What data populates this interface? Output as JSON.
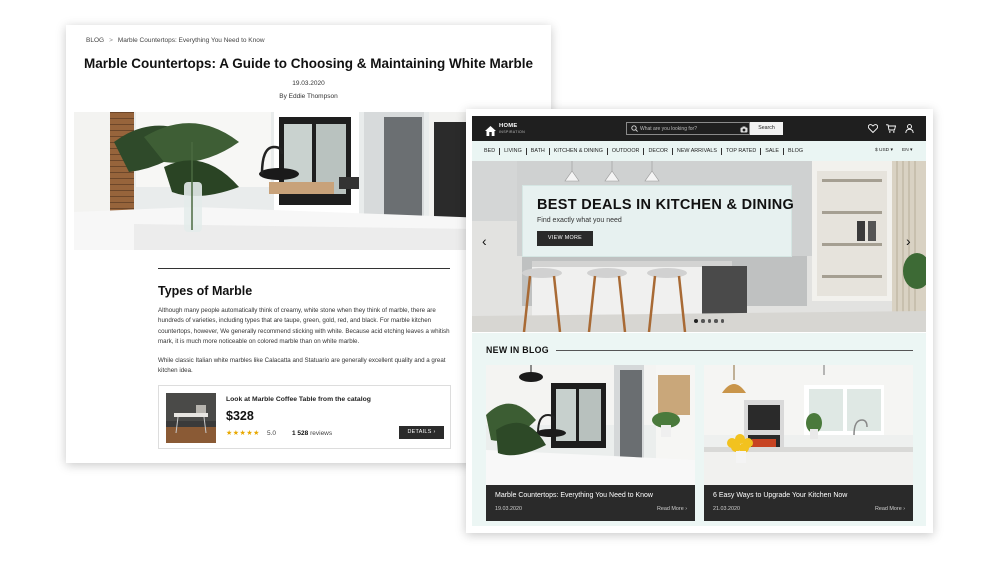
{
  "article": {
    "breadcrumb": {
      "root": "BLOG",
      "separator": ">",
      "current": "Marble Countertops: Everything You Need to Know"
    },
    "title": "Marble Countertops: A Guide to Choosing & Maintaining White Marble",
    "date": "19.03.2020",
    "author": "By Eddie Thompson",
    "section_heading": "Types of Marble",
    "paragraph1": "Although many people automatically think of creamy, white stone when they think of marble, there are hundreds of varieties, including types that are taupe, green, gold, red, and black. For marble kitchen countertops, however, We generally recommend sticking with white. Because acid etching leaves a whitish mark, it is much more noticeable on colored marble than on white marble.",
    "paragraph2": "While classic Italian white marbles like Calacatta and Statuario are generally excellent quality and a great kitchen idea.",
    "product": {
      "title": "Look at Marble Coffee Table from the catalog",
      "price": "$328",
      "stars": "★★★★★",
      "rating": "5.0",
      "reviews_count": "1 528",
      "reviews_label": "reviews",
      "details_label": "DETAILS",
      "details_arrow": "›"
    }
  },
  "store": {
    "logo": {
      "name": "HOME",
      "sub": "INSPIRATION"
    },
    "search": {
      "placeholder": "What are you looking for?",
      "button": "Search"
    },
    "nav": [
      "BED",
      "LIVING",
      "BATH",
      "KITCHEN & DINING",
      "OUTDOOR",
      "DECOR",
      "NEW ARRIVALS",
      "TOP RATED",
      "SALE",
      "BLOG"
    ],
    "currency": "$ USD ▾",
    "language": "EN ▾",
    "hero": {
      "title": "BEST DEALS IN KITCHEN & DINING",
      "subtitle": "Find exactly what you need",
      "button": "VIEW MORE",
      "prev_arrow": "‹",
      "next_arrow": "›"
    },
    "blog": {
      "heading": "NEW IN BLOG",
      "posts": [
        {
          "title": "Marble Countertops: Everything You Need to Know",
          "date": "19.03.2020",
          "more": "Read More ›"
        },
        {
          "title": "6 Easy Ways to Upgrade Your Kitchen Now",
          "date": "21.03.2020",
          "more": "Read More ›"
        }
      ]
    }
  },
  "colors": {
    "topbar": "#1f1f1f",
    "nav_bg": "#eaf5f3",
    "blog_bg": "#ecf6f4",
    "button_dark": "#2a2a2a",
    "star": "#e8a800"
  }
}
